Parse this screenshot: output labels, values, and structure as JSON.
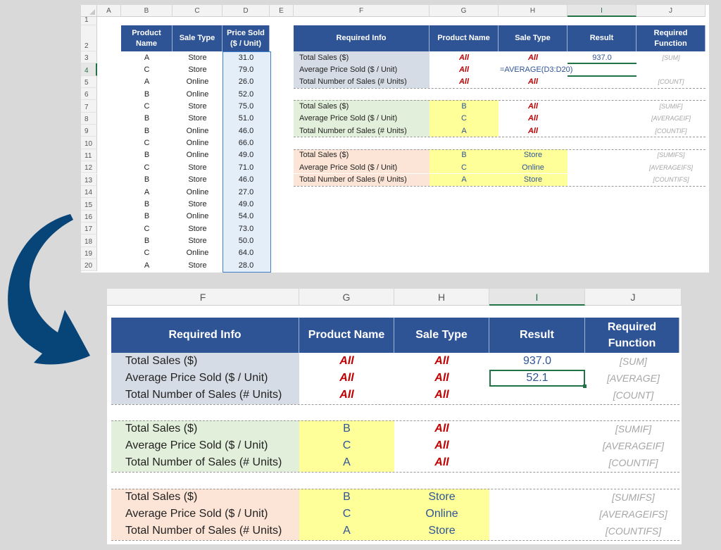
{
  "top_sheet": {
    "columns": [
      "A",
      "B",
      "C",
      "D",
      "E",
      "F",
      "G",
      "H",
      "I",
      "J"
    ],
    "selected_column": "I",
    "rows": [
      "1",
      "2",
      "3",
      "4",
      "5",
      "6",
      "7",
      "8",
      "9",
      "10",
      "11",
      "12",
      "13",
      "14",
      "15",
      "16",
      "17",
      "18",
      "19",
      "20"
    ],
    "selected_row": "4",
    "data_table": {
      "headers": [
        "Product Name",
        "Sale Type",
        "Price Sold ($ / Unit)"
      ],
      "header_lines": [
        [
          "Product",
          "Name"
        ],
        [
          "Sale Type"
        ],
        [
          "Price Sold",
          "($ / Unit)"
        ]
      ],
      "rows": [
        [
          "A",
          "Store",
          "31.0"
        ],
        [
          "C",
          "Store",
          "79.0"
        ],
        [
          "A",
          "Online",
          "26.0"
        ],
        [
          "B",
          "Online",
          "52.0"
        ],
        [
          "C",
          "Store",
          "75.0"
        ],
        [
          "B",
          "Store",
          "51.0"
        ],
        [
          "B",
          "Online",
          "46.0"
        ],
        [
          "C",
          "Online",
          "66.0"
        ],
        [
          "B",
          "Online",
          "49.0"
        ],
        [
          "C",
          "Store",
          "71.0"
        ],
        [
          "B",
          "Store",
          "46.0"
        ],
        [
          "A",
          "Online",
          "27.0"
        ],
        [
          "B",
          "Store",
          "49.0"
        ],
        [
          "B",
          "Online",
          "54.0"
        ],
        [
          "C",
          "Store",
          "73.0"
        ],
        [
          "B",
          "Store",
          "50.0"
        ],
        [
          "C",
          "Online",
          "64.0"
        ],
        [
          "A",
          "Store",
          "28.0"
        ]
      ]
    },
    "summary_table": {
      "headers": [
        "Required Info",
        "Product Name",
        "Sale Type",
        "Result",
        "Required Function"
      ],
      "header_lines": [
        [
          "Required Info"
        ],
        [
          "Product Name"
        ],
        [
          "Sale Type"
        ],
        [
          "Result"
        ],
        [
          "Required",
          "Function"
        ]
      ],
      "groups": [
        {
          "color": "gray",
          "rows": [
            {
              "info": "Total Sales ($)",
              "product": "All",
              "sale_type": "All",
              "result": "937.0",
              "function": "[SUM]"
            },
            {
              "info": "Average Price Sold ($ / Unit)",
              "product": "All",
              "sale_type": "",
              "result": "",
              "function": "",
              "editing_formula": "=AVERAGE(D3:D20)"
            },
            {
              "info": "Total Number of Sales (# Units)",
              "product": "All",
              "sale_type": "All",
              "result": "",
              "function": "[COUNT]"
            }
          ]
        },
        {
          "color": "green",
          "rows": [
            {
              "info": "Total Sales ($)",
              "product": "B",
              "sale_type": "All",
              "result": "",
              "function": "[SUMIF]"
            },
            {
              "info": "Average Price Sold ($ / Unit)",
              "product": "C",
              "sale_type": "All",
              "result": "",
              "function": "[AVERAGEIF]"
            },
            {
              "info": "Total Number of Sales (# Units)",
              "product": "A",
              "sale_type": "All",
              "result": "",
              "function": "[COUNTIF]"
            }
          ]
        },
        {
          "color": "peach",
          "rows": [
            {
              "info": "Total Sales ($)",
              "product": "B",
              "sale_type": "Store",
              "result": "",
              "function": "[SUMIFS]"
            },
            {
              "info": "Average Price Sold ($ / Unit)",
              "product": "C",
              "sale_type": "Online",
              "result": "",
              "function": "[AVERAGEIFS]"
            },
            {
              "info": "Total Number of Sales (# Units)",
              "product": "A",
              "sale_type": "Store",
              "result": "",
              "function": "[COUNTIFS]"
            }
          ]
        }
      ]
    }
  },
  "bottom_sheet": {
    "columns": [
      "F",
      "G",
      "H",
      "I",
      "J"
    ],
    "selected_column": "I",
    "headers": [
      "Required Info",
      "Product Name",
      "Sale Type",
      "Result",
      "Required Function"
    ],
    "header_lines": [
      [
        "Required Info"
      ],
      [
        "Product Name"
      ],
      [
        "Sale Type"
      ],
      [
        "Result"
      ],
      [
        "Required",
        "Function"
      ]
    ],
    "selected_cell_value": "52.1",
    "groups": [
      {
        "color": "gray",
        "rows": [
          {
            "info": "Total Sales ($)",
            "product": "All",
            "sale_type": "All",
            "result": "937.0",
            "function": "[SUM]"
          },
          {
            "info": "Average Price Sold ($ / Unit)",
            "product": "All",
            "sale_type": "All",
            "result": "52.1",
            "function": "[AVERAGE]"
          },
          {
            "info": "Total Number of Sales (# Units)",
            "product": "All",
            "sale_type": "All",
            "result": "",
            "function": "[COUNT]"
          }
        ]
      },
      {
        "color": "green",
        "rows": [
          {
            "info": "Total Sales ($)",
            "product": "B",
            "sale_type": "All",
            "result": "",
            "function": "[SUMIF]"
          },
          {
            "info": "Average Price Sold ($ / Unit)",
            "product": "C",
            "sale_type": "All",
            "result": "",
            "function": "[AVERAGEIF]"
          },
          {
            "info": "Total Number of Sales (# Units)",
            "product": "A",
            "sale_type": "All",
            "result": "",
            "function": "[COUNTIF]"
          }
        ]
      },
      {
        "color": "peach",
        "rows": [
          {
            "info": "Total Sales ($)",
            "product": "B",
            "sale_type": "Store",
            "result": "",
            "function": "[SUMIFS]"
          },
          {
            "info": "Average Price Sold ($ / Unit)",
            "product": "C",
            "sale_type": "Online",
            "result": "",
            "function": "[AVERAGEIFS]"
          },
          {
            "info": "Total Number of Sales (# Units)",
            "product": "A",
            "sale_type": "Store",
            "result": "",
            "function": "[COUNTIFS]"
          }
        ]
      }
    ]
  },
  "decor": {
    "arrow_icon": "curved-arrow-down-right",
    "colors": {
      "header_blue": "#2f5496",
      "all_red": "#c00000",
      "value_blue": "#2f5496",
      "group_gray": "#d6dce5",
      "group_green": "#e2efda",
      "group_peach": "#fce4d6",
      "input_yellow": "#ffff99",
      "excel_green": "#217346",
      "arrow_navy": "#074478"
    }
  }
}
